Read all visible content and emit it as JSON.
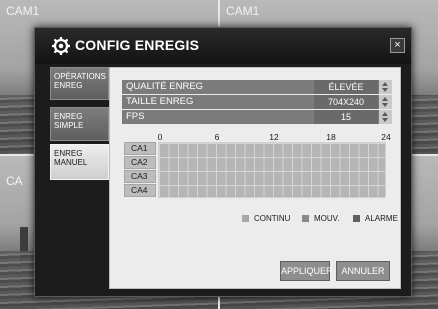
{
  "cameras": [
    "CAM1",
    "CAM1",
    "CA"
  ],
  "dialog": {
    "title": "CONFIG ENREGIS",
    "close_label": "×",
    "tabs": [
      {
        "line1": "OPÉRATIONS",
        "line2": "ENREG",
        "active": false
      },
      {
        "line1": "ENREG",
        "line2": "SIMPLE",
        "active": false
      },
      {
        "line1": "ENREG",
        "line2": "MANUEL",
        "active": true
      }
    ],
    "params": [
      {
        "label": "QUALITÉ ENREG",
        "value": "ÉLEVÉE"
      },
      {
        "label": "TAILLE ENREG",
        "value": "704X240"
      },
      {
        "label": "FPS",
        "value": "15"
      }
    ],
    "schedule": {
      "hours": [
        "0",
        "6",
        "12",
        "18",
        "24"
      ],
      "channels": [
        "CA1",
        "CA2",
        "CA3",
        "CA4"
      ]
    },
    "legend": [
      {
        "label": "CONTINU",
        "color": "#a8a8a8"
      },
      {
        "label": "MOUV.",
        "color": "#8a8a8a"
      },
      {
        "label": "ALARME",
        "color": "#5f5f5f"
      }
    ],
    "buttons": {
      "apply": "APPLIQUER",
      "cancel": "ANNULER"
    }
  }
}
